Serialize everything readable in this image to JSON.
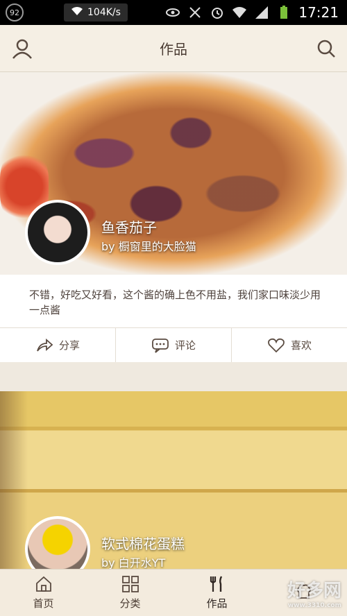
{
  "status_bar": {
    "battery_percent": "92",
    "net_speed": "104K/s",
    "time": "17:21"
  },
  "header": {
    "title": "作品",
    "profile_icon": "user-icon",
    "search_icon": "search-icon"
  },
  "feed": [
    {
      "dish_name": "鱼香茄子",
      "author": "by 橱窗里的大脸猫",
      "description": "不错，好吃又好看，这个酱的确上色不用盐，我们家口味淡少用一点酱",
      "actions": [
        {
          "label": "分享",
          "icon": "share-icon"
        },
        {
          "label": "评论",
          "icon": "comment-icon"
        },
        {
          "label": "喜欢",
          "icon": "heart-icon"
        }
      ]
    },
    {
      "dish_name": "软式棉花蛋糕",
      "author": "by 白开水YT"
    }
  ],
  "bottom_nav": [
    {
      "label": "首页",
      "icon": "home-icon"
    },
    {
      "label": "分类",
      "icon": "grid-icon"
    },
    {
      "label": "作品",
      "icon": "fork-knife-icon"
    },
    {
      "label": "",
      "icon": "chef-icon"
    }
  ],
  "watermark": {
    "text": "好多网",
    "sub": "www.3310.com"
  }
}
